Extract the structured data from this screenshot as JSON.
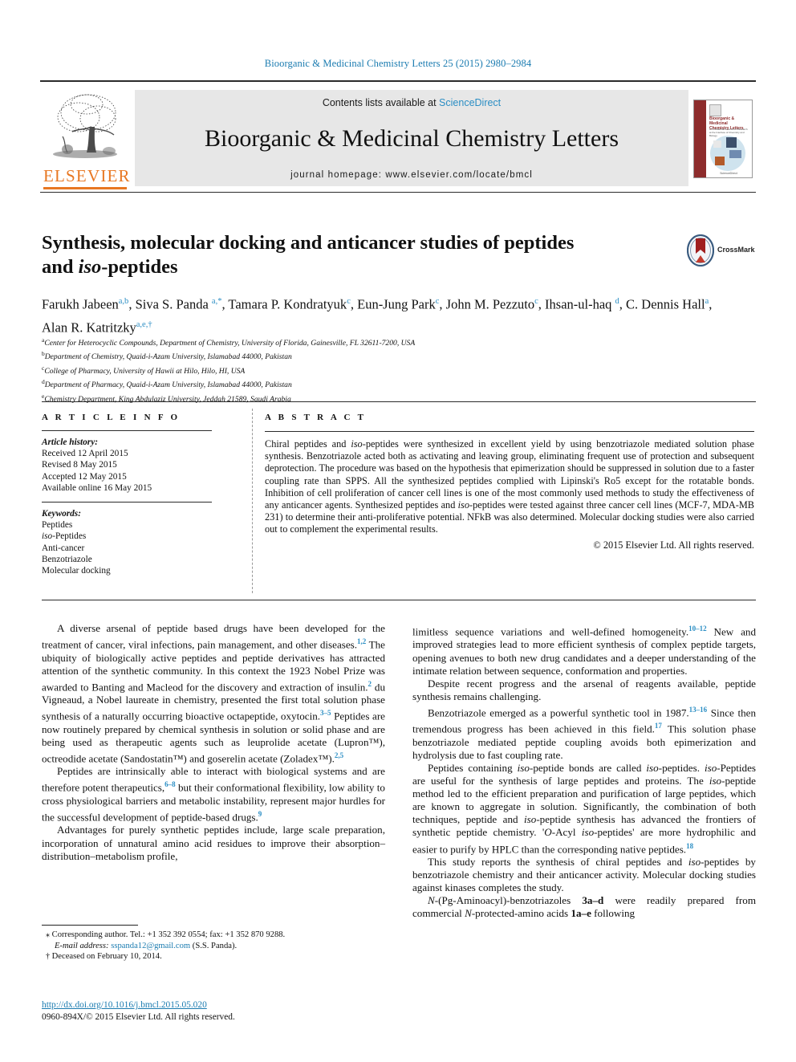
{
  "runningHead": "Bioorganic & Medicinal Chemistry Letters 25 (2015) 2980–2984",
  "masthead": {
    "publisher": "ELSEVIER",
    "contents_prefix": "Contents lists available at ",
    "contents_link": "ScienceDirect",
    "journal_title": "Bioorganic & Medicinal Chemistry Letters",
    "homepage": "journal homepage: www.elsevier.com/locate/bmcl",
    "cover": {
      "title": "Bioorganic & Medicinal Chemistry Letters",
      "subtitle": "An Invitational Journal for Research at the Interface of Chemistry and Biology",
      "edition": "21st Anniversary Volume",
      "footer": "ScienceDirect"
    },
    "accent_color": "#E87722",
    "link_color": "#2b8ec4"
  },
  "article": {
    "title_line1": "Synthesis, molecular docking and anticancer studies of peptides",
    "title_line2_pre": "and ",
    "title_line2_em": "iso",
    "title_line2_post": "-peptides",
    "crossmark_label": "CrossMark",
    "authors": [
      {
        "name": "Farukh Jabeen",
        "sup": "a,b",
        "sep": ", "
      },
      {
        "name": "Siva S. Panda ",
        "sup": "a,*",
        "sep": ", "
      },
      {
        "name": "Tamara P. Kondratyuk",
        "sup": "c",
        "sep": ", "
      },
      {
        "name": "Eun-Jung Park",
        "sup": "c",
        "sep": ", "
      },
      {
        "name": "John M. Pezzuto",
        "sup": "c",
        "sep": ", "
      },
      {
        "name": "Ihsan-ul-haq ",
        "sup": "d",
        "sep": ", "
      },
      {
        "name": "C. Dennis Hall",
        "sup": "a",
        "sep": ", "
      },
      {
        "name": "Alan R. Katritzky",
        "sup": "a,e,†",
        "sep": ""
      }
    ],
    "affiliations": [
      {
        "mark": "a",
        "text": "Center for Heterocyclic Compounds, Department of Chemistry, University of Florida, Gainesville, FL 32611-7200, USA"
      },
      {
        "mark": "b",
        "text": "Department of Chemistry, Quaid-i-Azam University, Islamabad 44000, Pakistan"
      },
      {
        "mark": "c",
        "text": "College of Pharmacy, University of Hawii at Hilo, Hilo, HI, USA"
      },
      {
        "mark": "d",
        "text": "Department of Pharmacy, Quaid-i-Azam University, Islamabad 44000, Pakistan"
      },
      {
        "mark": "e",
        "text": "Chemistry Department, King Abdulaziz University, Jeddah 21589, Saudi Arabia"
      }
    ]
  },
  "articleInfo": {
    "heading": "A R T I C L E   I N F O",
    "history_label": "Article history:",
    "history": [
      "Received 12 April 2015",
      "Revised 8 May 2015",
      "Accepted 12 May 2015",
      "Available online 16 May 2015"
    ],
    "keywords_label": "Keywords:",
    "keywords": [
      "Peptides",
      "iso-Peptides",
      "Anti-cancer",
      "Benzotriazole",
      "Molecular docking"
    ]
  },
  "abstract": {
    "heading": "A B S T R A C T",
    "body": "Chiral peptides and iso-peptides were synthesized in excellent yield by using benzotriazole mediated solution phase synthesis. Benzotriazole acted both as activating and leaving group, eliminating frequent use of protection and subsequent deprotection. The procedure was based on the hypothesis that epimerization should be suppressed in solution due to a faster coupling rate than SPPS. All the synthesized peptides complied with Lipinski's Ro5 except for the rotatable bonds. Inhibition of cell proliferation of cancer cell lines is one of the most commonly used methods to study the effectiveness of any anticancer agents. Synthesized peptides and iso-peptides were tested against three cancer cell lines (MCF-7, MDA-MB 231) to determine their anti-proliferative potential. NFkB was also determined. Molecular docking studies were also carried out to complement the experimental results.",
    "copyright": "© 2015 Elsevier Ltd. All rights reserved."
  },
  "body": {
    "left_paragraphs": [
      "A diverse arsenal of peptide based drugs have been developed for the treatment of cancer, viral infections, pain management, and other diseases.[1,2] The ubiquity of biologically active peptides and peptide derivatives has attracted attention of the synthetic community. In this context the 1923 Nobel Prize was awarded to Banting and Macleod for the discovery and extraction of insulin.[2] du Vigneaud, a Nobel laureate in chemistry, presented the first total solution phase synthesis of a naturally occurring bioactive octapeptide, oxytocin.[3–5] Peptides are now routinely prepared by chemical synthesis in solution or solid phase and are being used as therapeutic agents such as leuprolide acetate (Lupron™), octreodide acetate (Sandostatin™) and goserelin acetate (Zoladex™).[2,5]",
      "Peptides are intrinsically able to interact with biological systems and are therefore potent therapeutics,[6–8] but their conformational flexibility, low ability to cross physiological barriers and metabolic instability, represent major hurdles for the successful development of peptide-based drugs.[9]",
      "Advantages for purely synthetic peptides include, large scale preparation, incorporation of unnatural amino acid residues to improve their absorption–distribution–metabolism profile,"
    ],
    "right_paragraphs": [
      "limitless sequence variations and well-defined homogeneity.[10–12] New and improved strategies lead to more efficient synthesis of complex peptide targets, opening avenues to both new drug candidates and a deeper understanding of the intimate relation between sequence, conformation and properties.",
      "Despite recent progress and the arsenal of reagents available, peptide synthesis remains challenging.",
      "Benzotriazole emerged as a powerful synthetic tool in 1987.[13–16] Since then tremendous progress has been achieved in this field.[17] This solution phase benzotriazole mediated peptide coupling avoids both epimerization and hydrolysis due to fast coupling rate.",
      "Peptides containing iso-peptide bonds are called iso-peptides. iso-Peptides are useful for the synthesis of large peptides and proteins. The iso-peptide method led to the efficient preparation and purification of large peptides, which are known to aggregate in solution. Significantly, the combination of both techniques, peptide and iso-peptide synthesis has advanced the frontiers of synthetic peptide chemistry. 'O-Acyl iso-peptides' are more hydrophilic and easier to purify by HPLC than the corresponding native peptides.[18]",
      "This study reports the synthesis of chiral peptides and iso-peptides by benzotriazole chemistry and their anticancer activity. Molecular docking studies against kinases completes the study.",
      "N-(Pg-Aminoacyl)-benzotriazoles 3a–d were readily prepared from commercial N-protected-amino acids 1a–e following"
    ]
  },
  "footnotes": {
    "corresponding_mark": "⁎",
    "corresponding": "Corresponding author. Tel.: +1 352 392 0554; fax: +1 352 870 9288.",
    "email_label": "E-mail address:",
    "email": "sspanda12@gmail.com",
    "email_owner": "(S.S. Panda).",
    "deceased_mark": "†",
    "deceased": "Deceased on February 10, 2014."
  },
  "footer": {
    "doi": "http://dx.doi.org/10.1016/j.bmcl.2015.05.020",
    "issn": "0960-894X/© 2015 Elsevier Ltd. All rights reserved."
  }
}
